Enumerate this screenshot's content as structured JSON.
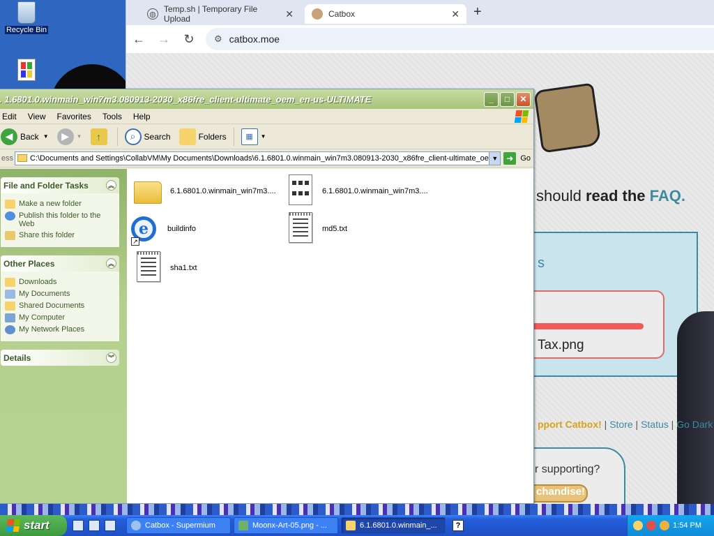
{
  "desktop": {
    "icons": [
      {
        "label": "Recycle Bin",
        "icon": "recycle-bin-icon"
      }
    ]
  },
  "browser": {
    "tabs": [
      {
        "title": "Temp.sh | Temporary File Upload",
        "icon": "globe-icon"
      },
      {
        "title": "Catbox",
        "icon": "catbox-favicon"
      }
    ],
    "url": "catbox.moe",
    "page": {
      "faq_prefix": "should ",
      "faq_bold": "read the ",
      "faq_link": "FAQ.",
      "upload_letter": "s",
      "filename": "Tax.png",
      "support_link": "pport Catbox!",
      "links": [
        "Store",
        "Status",
        "Go Dark"
      ],
      "link_sep": " | ",
      "supporting": "r supporting?",
      "merch": "chandise!"
    }
  },
  "explorer": {
    "title": ". 1.6801.0.winmain_win7m3.080913-2030_x86fre_client-ultimate_oem_en-us-ULTIMATE",
    "menu": [
      "Edit",
      "View",
      "Favorites",
      "Tools",
      "Help"
    ],
    "toolbar": {
      "back": "Back",
      "search": "Search",
      "folders": "Folders"
    },
    "address": {
      "label": "ess",
      "path": "C:\\Documents and Settings\\CollabVM\\My Documents\\Downloads\\6.1.6801.0.winmain_win7m3.080913-2030_x86fre_client-ultimate_oe",
      "go": "Go"
    },
    "tasks": {
      "file_folder_title": "File and Folder Tasks",
      "file_folder_items": [
        "Make a new folder",
        "Publish this folder to the Web",
        "Share this folder"
      ],
      "other_places_title": "Other Places",
      "other_places_items": [
        "Downloads",
        "My Documents",
        "Shared Documents",
        "My Computer",
        "My Network Places"
      ],
      "details_title": "Details"
    },
    "files": [
      {
        "name": "6.1.6801.0.winmain_win7m3....",
        "type": "folder"
      },
      {
        "name": "6.1.6801.0.winmain_win7m3....",
        "type": "app"
      },
      {
        "name": "buildinfo",
        "type": "ie-shortcut"
      },
      {
        "name": "md5.txt",
        "type": "text"
      },
      {
        "name": "sha1.txt",
        "type": "text"
      }
    ]
  },
  "taskbar": {
    "start": "start",
    "tasks": [
      {
        "label": "Catbox - Supermium",
        "icon": "browser-icon"
      },
      {
        "label": "Moonx-Art-05.png - ...",
        "icon": "image-icon"
      },
      {
        "label": "6.1.6801.0.winmain_...",
        "icon": "folder-icon"
      }
    ],
    "clock": "1:54 PM"
  },
  "colors": {
    "desktop_blue": "#2f66c0",
    "xp_olive_title": "#a8c47a",
    "catbox_teal": "#3f8a9e",
    "progress_red": "#f05a5a",
    "taskbar_blue": "#245edb"
  }
}
